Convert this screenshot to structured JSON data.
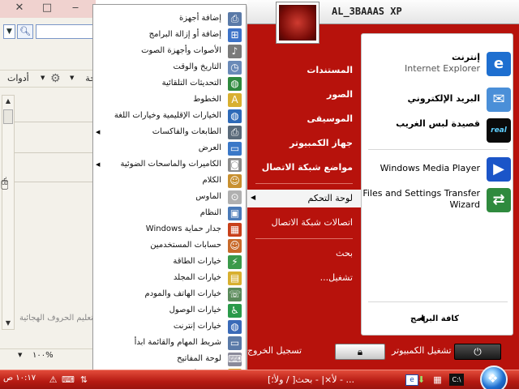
{
  "background_window": {
    "title_buttons": {
      "close": "✕",
      "maximize": "□",
      "minimize": "‒"
    },
    "toolbar": {
      "page_label": "حة",
      "tools_label": "أدوات"
    },
    "panel_text": "تعليم الحروف الهجائية",
    "zoom": "١٠٠%"
  },
  "start_menu": {
    "username": "AL_3BAAAS XP",
    "pinned": [
      {
        "label": "إنترنت",
        "sub": "Internet Explorer",
        "icon": "ie-icon"
      },
      {
        "label": "البريد الإلكتروني",
        "sub": "",
        "icon": "mail-icon"
      },
      {
        "label": "قصيدة لبس الغريب",
        "sub": "",
        "icon": "realplayer-icon"
      },
      {
        "label": "Windows Media Player",
        "sub": "",
        "icon": "media-player-icon"
      },
      {
        "label": "Files and Settings Transfer",
        "sub": "Wizard",
        "icon": "transfer-wizard-icon"
      }
    ],
    "all_programs": "كافة البرامج",
    "right_items": [
      {
        "label": "المستندات",
        "bold": true
      },
      {
        "label": "الصور",
        "bold": true
      },
      {
        "label": "الموسيقى",
        "bold": true
      },
      {
        "label": "جهاز الكمبيوتر",
        "bold": true
      },
      {
        "label": "مواضع شبكة الاتصال",
        "bold": true
      },
      {
        "label": "لوحة التحكم",
        "bold": false
      },
      {
        "label": "اتصالات شبكة الاتصال",
        "bold": false
      },
      {
        "label": "بحث",
        "bold": false
      },
      {
        "label": "تشغيل...",
        "bold": false
      }
    ],
    "footer": {
      "logoff": "تسجيل الخروج",
      "shutdown": "إيقاف تشغيل الكمبيوتر"
    }
  },
  "control_panel_menu": {
    "items": [
      {
        "label": "إضافة أجهزة",
        "icon": "printer-icon",
        "submenu": false
      },
      {
        "label": "إضافة أو إزالة البرامج",
        "icon": "programs-icon",
        "submenu": false
      },
      {
        "label": "الأصوات وأجهزة الصوت",
        "icon": "speaker-icon",
        "submenu": false
      },
      {
        "label": "التاريخ والوقت",
        "icon": "clock-icon",
        "submenu": false
      },
      {
        "label": "التحديثات التلقائية",
        "icon": "globe-icon",
        "submenu": false
      },
      {
        "label": "الخطوط",
        "icon": "folder-icon",
        "submenu": false
      },
      {
        "label": "الخيارات الإقليمية وخيارات اللغة",
        "icon": "globe-language-icon",
        "submenu": false
      },
      {
        "label": "الطابعات والفاكسات",
        "icon": "printer-fax-icon",
        "submenu": true
      },
      {
        "label": "العرض",
        "icon": "display-icon",
        "submenu": false
      },
      {
        "label": "الكاميرات والماسحات الضوئية",
        "icon": "camera-icon",
        "submenu": true
      },
      {
        "label": "الكلام",
        "icon": "speech-icon",
        "submenu": false
      },
      {
        "label": "الماوس",
        "icon": "mouse-icon",
        "submenu": false
      },
      {
        "label": "النظام",
        "icon": "system-icon",
        "submenu": false
      },
      {
        "label": "جدار حماية Windows",
        "icon": "firewall-icon",
        "submenu": false
      },
      {
        "label": "حسابات المستخدمين",
        "icon": "users-icon",
        "submenu": false
      },
      {
        "label": "خيارات الطاقة",
        "icon": "power-icon",
        "submenu": false
      },
      {
        "label": "خيارات المجلد",
        "icon": "folder-options-icon",
        "submenu": false
      },
      {
        "label": "خيارات الهاتف والمودم",
        "icon": "phone-icon",
        "submenu": false
      },
      {
        "label": "خيارات الوصول",
        "icon": "accessibility-icon",
        "submenu": false
      },
      {
        "label": "خيارات إنترنت",
        "icon": "internet-options-icon",
        "submenu": false
      },
      {
        "label": "شريط المهام والقائمة ابدأ",
        "icon": "taskbar-icon",
        "submenu": false
      },
      {
        "label": "لوحة المفاتيح",
        "icon": "keyboard-icon",
        "submenu": false
      },
      {
        "label": "مركز الأمان",
        "icon": "shield-icon",
        "submenu": false
      }
    ]
  },
  "taskbar": {
    "clock": "١٠:١٧ ص",
    "task_label": "[ولأ؛ / ]لأ×| - بحث - ..."
  }
}
